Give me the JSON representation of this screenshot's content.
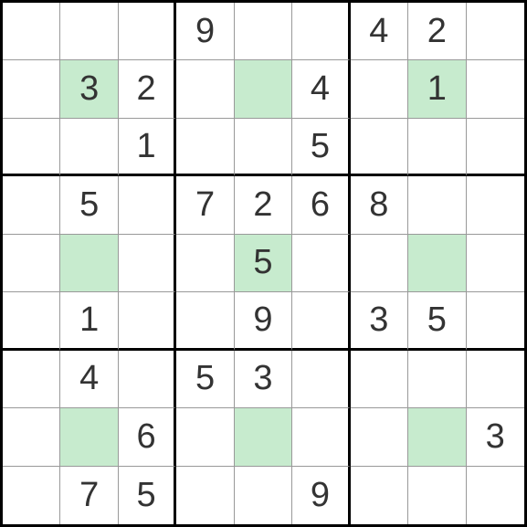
{
  "sudoku": {
    "grid": [
      [
        "",
        "",
        "",
        "9",
        "",
        "",
        "4",
        "2",
        ""
      ],
      [
        "",
        "3",
        "2",
        "",
        "",
        "4",
        "",
        "1",
        ""
      ],
      [
        "",
        "",
        "1",
        "",
        "",
        "5",
        "",
        "",
        ""
      ],
      [
        "",
        "5",
        "",
        "7",
        "2",
        "6",
        "8",
        "",
        ""
      ],
      [
        "",
        "",
        "",
        "",
        "5",
        "",
        "",
        "",
        ""
      ],
      [
        "",
        "1",
        "",
        "",
        "9",
        "",
        "3",
        "5",
        ""
      ],
      [
        "",
        "4",
        "",
        "5",
        "3",
        "",
        "",
        "",
        ""
      ],
      [
        "",
        "",
        "6",
        "",
        "",
        "",
        "",
        "",
        "3"
      ],
      [
        "",
        "7",
        "5",
        "",
        "",
        "9",
        "",
        "",
        ""
      ]
    ],
    "highlights": [
      [
        1,
        1
      ],
      [
        1,
        4
      ],
      [
        1,
        7
      ],
      [
        4,
        1
      ],
      [
        4,
        4
      ],
      [
        4,
        7
      ],
      [
        7,
        1
      ],
      [
        7,
        4
      ],
      [
        7,
        7
      ]
    ]
  },
  "colors": {
    "highlight": "#c7ebce",
    "grid_thin": "#999999",
    "grid_thick": "#000000",
    "text": "#333333",
    "background": "#ffffff"
  },
  "chart_data": {
    "type": "table",
    "title": "Sudoku Puzzle 9x9",
    "rows": 9,
    "cols": 9,
    "values": [
      [
        "",
        "",
        "",
        "9",
        "",
        "",
        "4",
        "2",
        ""
      ],
      [
        "",
        "3",
        "2",
        "",
        "",
        "4",
        "",
        "1",
        ""
      ],
      [
        "",
        "",
        "1",
        "",
        "",
        "5",
        "",
        "",
        ""
      ],
      [
        "",
        "5",
        "",
        "7",
        "2",
        "6",
        "8",
        "",
        ""
      ],
      [
        "",
        "",
        "",
        "",
        "5",
        "",
        "",
        "",
        ""
      ],
      [
        "",
        "1",
        "",
        "",
        "9",
        "",
        "3",
        "5",
        ""
      ],
      [
        "",
        "4",
        "",
        "5",
        "3",
        "",
        "",
        "",
        ""
      ],
      [
        "",
        "",
        "6",
        "",
        "",
        "",
        "",
        "",
        "3"
      ],
      [
        "",
        "7",
        "5",
        "",
        "",
        "9",
        "",
        "",
        ""
      ]
    ]
  }
}
